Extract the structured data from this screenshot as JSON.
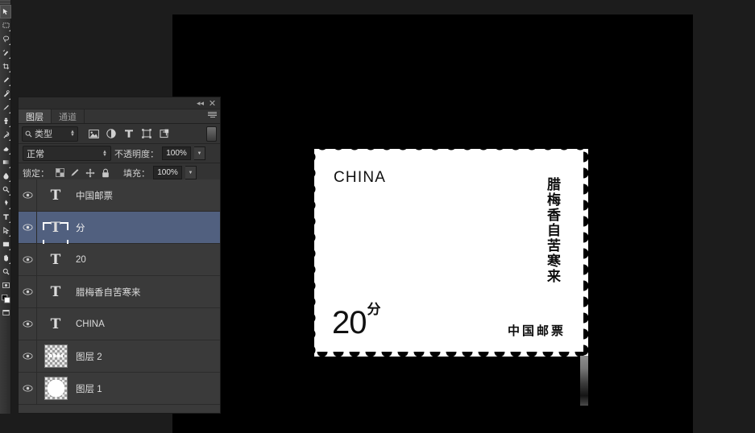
{
  "app": {
    "background_color": "#1c1c1c",
    "canvas_color": "#000000"
  },
  "toolbar": {
    "name": "tools-toolbar",
    "tools": [
      {
        "name": "move-tool",
        "selected": true
      },
      {
        "name": "marquee-tool",
        "selected": false
      },
      {
        "name": "lasso-tool",
        "selected": false
      },
      {
        "name": "quick-selection-tool",
        "selected": false
      },
      {
        "name": "crop-tool",
        "selected": false
      },
      {
        "name": "eyedropper-tool",
        "selected": false
      },
      {
        "name": "healing-brush-tool",
        "selected": false
      },
      {
        "name": "brush-tool",
        "selected": false
      },
      {
        "name": "clone-stamp-tool",
        "selected": false
      },
      {
        "name": "history-brush-tool",
        "selected": false
      },
      {
        "name": "eraser-tool",
        "selected": false
      },
      {
        "name": "gradient-tool",
        "selected": false
      },
      {
        "name": "blur-tool",
        "selected": false
      },
      {
        "name": "dodge-tool",
        "selected": false
      },
      {
        "name": "pen-tool",
        "selected": false
      },
      {
        "name": "type-tool",
        "selected": false
      },
      {
        "name": "path-selection-tool",
        "selected": false
      },
      {
        "name": "rectangle-tool",
        "selected": false
      },
      {
        "name": "hand-tool",
        "selected": false
      },
      {
        "name": "zoom-tool",
        "selected": false
      },
      {
        "name": "foreground-background-color",
        "selected": false
      }
    ]
  },
  "panel": {
    "titlebar": {
      "collapse_label": "◂◂",
      "close_label": "✕"
    },
    "tabs": [
      {
        "label": "图层",
        "active": true
      },
      {
        "label": "通道",
        "active": false
      }
    ],
    "filter_row": {
      "kind_label": "类型",
      "filters": [
        {
          "name": "filter-pixel-layers-icon"
        },
        {
          "name": "filter-adjustment-layers-icon"
        },
        {
          "name": "filter-type-layers-icon"
        },
        {
          "name": "filter-shape-layers-icon"
        },
        {
          "name": "filter-smart-object-layers-icon"
        }
      ],
      "toggle_name": "filter-enable-toggle"
    },
    "mode_row": {
      "blend_mode": "正常",
      "opacity_label": "不透明度：",
      "opacity_value": "100%"
    },
    "lock_row": {
      "lock_label": "锁定：",
      "lock_icons": [
        {
          "name": "lock-transparent-pixels-icon"
        },
        {
          "name": "lock-image-pixels-icon"
        },
        {
          "name": "lock-position-icon"
        },
        {
          "name": "lock-all-icon"
        }
      ],
      "fill_label": "填充：",
      "fill_value": "100%"
    },
    "layers": [
      {
        "name": "中国邮票",
        "type": "text",
        "visible": true,
        "selected": false
      },
      {
        "name": "分",
        "type": "text",
        "visible": true,
        "selected": true
      },
      {
        "name": "20",
        "type": "text",
        "visible": true,
        "selected": false
      },
      {
        "name": "腊梅香自苦寒来",
        "type": "text",
        "visible": true,
        "selected": false
      },
      {
        "name": "CHINA",
        "type": "text",
        "visible": true,
        "selected": false
      },
      {
        "name": "图层 2",
        "type": "pixel-dashed",
        "visible": true,
        "selected": false
      },
      {
        "name": "图层 1",
        "type": "pixel-blob",
        "visible": true,
        "selected": false
      }
    ]
  },
  "artwork": {
    "title": "china-postage-stamp",
    "country": "CHINA",
    "poem": "腊梅香自苦寒来",
    "denomination_number": "20",
    "denomination_unit": "分",
    "issuer": "中国邮票",
    "paper_color": "#ffffff",
    "ink_color": "#0d0d0d"
  }
}
